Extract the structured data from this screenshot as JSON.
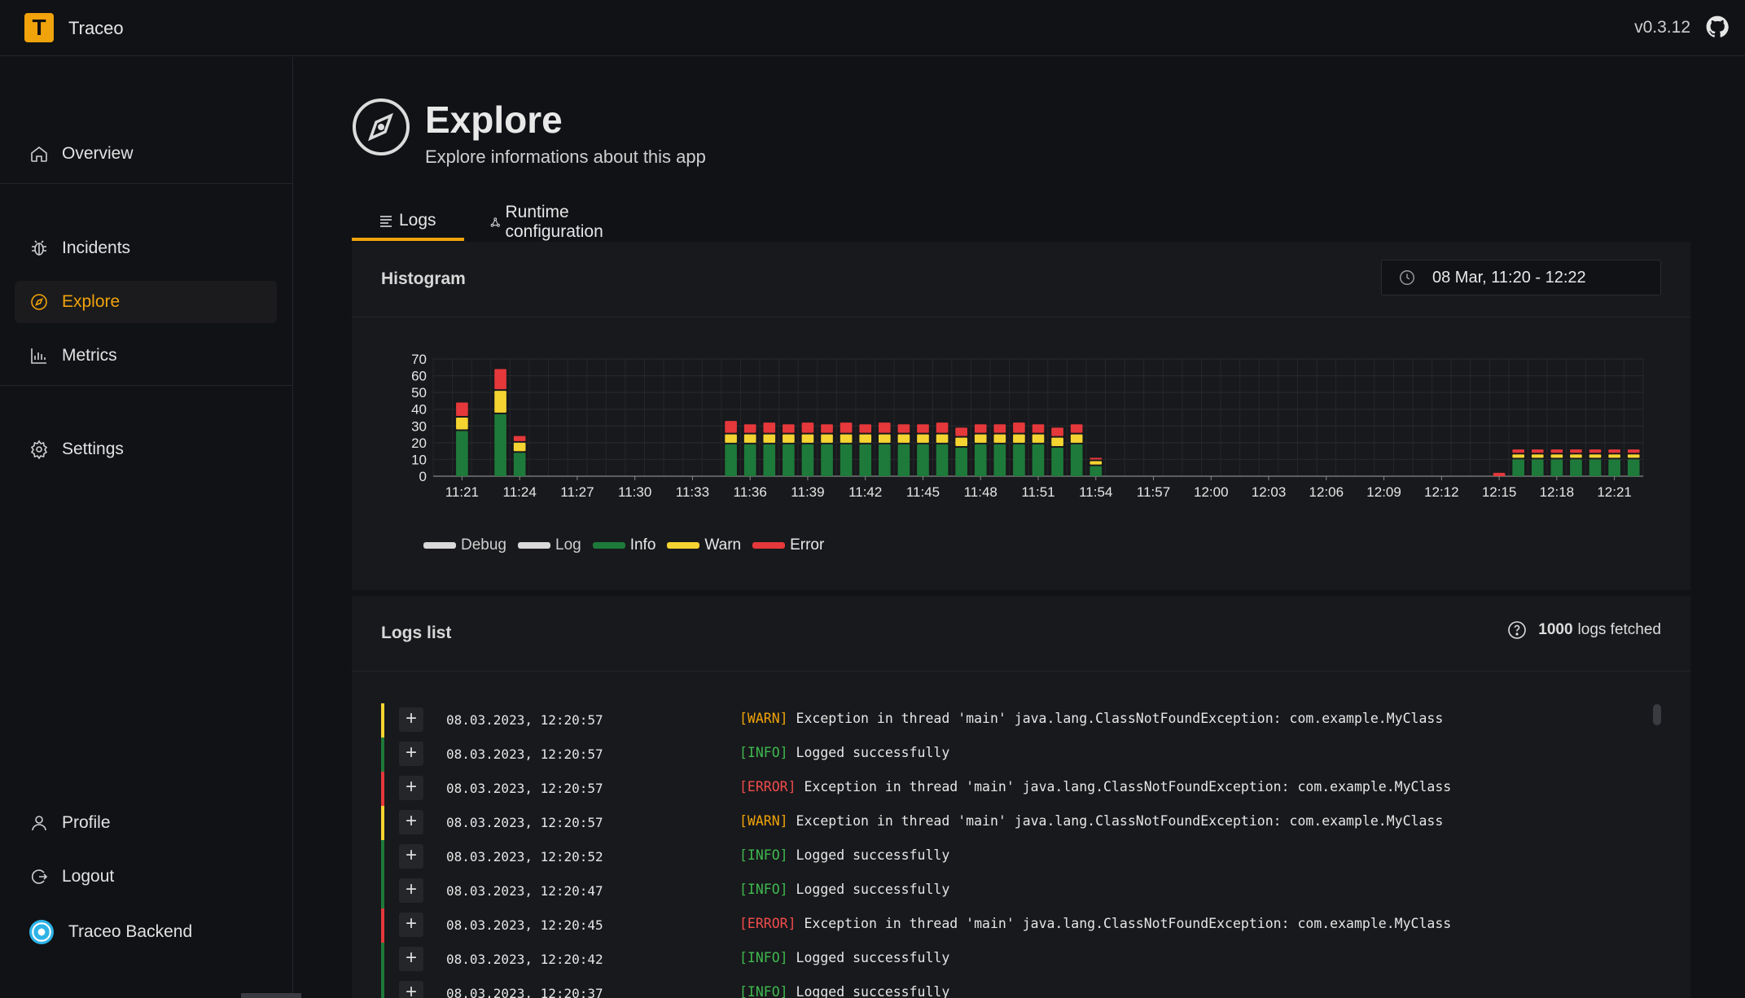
{
  "app": {
    "logo_letter": "T",
    "name": "Traceo",
    "version": "v0.3.12"
  },
  "sidebar": {
    "items": [
      {
        "label": "Overview",
        "icon": "home-icon"
      },
      {
        "label": "Incidents",
        "icon": "bug-icon"
      },
      {
        "label": "Explore",
        "icon": "compass-icon",
        "active": true
      },
      {
        "label": "Metrics",
        "icon": "bar-chart-icon"
      },
      {
        "label": "Settings",
        "icon": "gear-icon"
      }
    ],
    "bottom": [
      {
        "label": "Profile",
        "icon": "user-icon"
      },
      {
        "label": "Logout",
        "icon": "logout-icon"
      },
      {
        "label": "Traceo Backend",
        "icon": "project-avatar"
      }
    ]
  },
  "page": {
    "title": "Explore",
    "subtitle": "Explore informations about this app"
  },
  "tabs": [
    {
      "label": "Logs",
      "active": true
    },
    {
      "label": "Runtime configuration"
    }
  ],
  "histogram": {
    "title": "Histogram",
    "time_range": "08 Mar, 11:20 - 12:22",
    "legend": [
      {
        "label": "Debug",
        "color": "#d9d9d9"
      },
      {
        "label": "Log",
        "color": "#d9d9d9"
      },
      {
        "label": "Info",
        "color": "#1e7a3a"
      },
      {
        "label": "Warn",
        "color": "#f5d431"
      },
      {
        "label": "Error",
        "color": "#e5383b"
      }
    ]
  },
  "chart_data": {
    "type": "bar",
    "stacked": true,
    "y_ticks": [
      0,
      10,
      20,
      30,
      40,
      50,
      60,
      70
    ],
    "ylim": [
      0,
      70
    ],
    "x_ticks": [
      "11:21",
      "11:24",
      "11:27",
      "11:30",
      "11:33",
      "11:36",
      "11:39",
      "11:42",
      "11:45",
      "11:48",
      "11:51",
      "11:54",
      "11:57",
      "12:00",
      "12:03",
      "12:06",
      "12:09",
      "12:12",
      "12:15",
      "12:18",
      "12:21"
    ],
    "x_range_minutes": [
      0,
      63
    ],
    "grid": true,
    "series": [
      {
        "name": "Info",
        "color": "#1e7a3a",
        "bars": [
          [
            1,
            27
          ],
          [
            3,
            37
          ],
          [
            4,
            14
          ],
          [
            15,
            19
          ],
          [
            16,
            19
          ],
          [
            17,
            19
          ],
          [
            18,
            19
          ],
          [
            19,
            19
          ],
          [
            20,
            19
          ],
          [
            21,
            19
          ],
          [
            22,
            19
          ],
          [
            23,
            19
          ],
          [
            24,
            19
          ],
          [
            25,
            19
          ],
          [
            26,
            19
          ],
          [
            27,
            17
          ],
          [
            28,
            19
          ],
          [
            29,
            19
          ],
          [
            30,
            19
          ],
          [
            31,
            19
          ],
          [
            32,
            17
          ],
          [
            33,
            19
          ],
          [
            34,
            6
          ],
          [
            56,
            10
          ],
          [
            57,
            10
          ],
          [
            58,
            10
          ],
          [
            59,
            10
          ],
          [
            60,
            10
          ],
          [
            61,
            10
          ],
          [
            62,
            10
          ]
        ]
      },
      {
        "name": "Warn",
        "color": "#f5d431",
        "bars": [
          [
            1,
            8
          ],
          [
            3,
            14
          ],
          [
            4,
            6
          ],
          [
            15,
            6
          ],
          [
            16,
            6
          ],
          [
            17,
            6
          ],
          [
            18,
            6
          ],
          [
            19,
            6
          ],
          [
            20,
            6
          ],
          [
            21,
            6
          ],
          [
            22,
            6
          ],
          [
            23,
            6
          ],
          [
            24,
            6
          ],
          [
            25,
            6
          ],
          [
            26,
            6
          ],
          [
            27,
            6
          ],
          [
            28,
            6
          ],
          [
            29,
            6
          ],
          [
            30,
            6
          ],
          [
            31,
            6
          ],
          [
            32,
            6
          ],
          [
            33,
            6
          ],
          [
            34,
            3
          ],
          [
            56,
            3
          ],
          [
            57,
            3
          ],
          [
            58,
            3
          ],
          [
            59,
            3
          ],
          [
            60,
            3
          ],
          [
            61,
            3
          ],
          [
            62,
            3
          ]
        ]
      },
      {
        "name": "Error",
        "color": "#e5383b",
        "bars": [
          [
            1,
            9
          ],
          [
            3,
            13
          ],
          [
            4,
            4
          ],
          [
            15,
            8
          ],
          [
            16,
            6
          ],
          [
            17,
            7
          ],
          [
            18,
            6
          ],
          [
            19,
            7
          ],
          [
            20,
            6
          ],
          [
            21,
            7
          ],
          [
            22,
            6
          ],
          [
            23,
            7
          ],
          [
            24,
            6
          ],
          [
            25,
            6
          ],
          [
            26,
            7
          ],
          [
            27,
            6
          ],
          [
            28,
            6
          ],
          [
            29,
            6
          ],
          [
            30,
            7
          ],
          [
            31,
            6
          ],
          [
            32,
            6
          ],
          [
            33,
            6
          ],
          [
            34,
            2
          ],
          [
            55,
            2
          ],
          [
            56,
            3
          ],
          [
            57,
            3
          ],
          [
            58,
            3
          ],
          [
            59,
            3
          ],
          [
            60,
            3
          ],
          [
            61,
            3
          ],
          [
            62,
            3
          ]
        ]
      }
    ]
  },
  "logs": {
    "title": "Logs list",
    "fetched_count": "1000",
    "fetched_suffix": "logs fetched",
    "rows": [
      {
        "time": "08.03.2023, 12:20:57",
        "level": "WARN",
        "tag": "[WARN]",
        "message": "Exception in thread 'main' java.lang.ClassNotFoundException: com.example.MyClass"
      },
      {
        "time": "08.03.2023, 12:20:57",
        "level": "INFO",
        "tag": "[INFO]",
        "message": "Logged successfully"
      },
      {
        "time": "08.03.2023, 12:20:57",
        "level": "ERROR",
        "tag": "[ERROR]",
        "message": "Exception in thread 'main' java.lang.ClassNotFoundException: com.example.MyClass"
      },
      {
        "time": "08.03.2023, 12:20:57",
        "level": "WARN",
        "tag": "[WARN]",
        "message": "Exception in thread 'main' java.lang.ClassNotFoundException: com.example.MyClass"
      },
      {
        "time": "08.03.2023, 12:20:52",
        "level": "INFO",
        "tag": "[INFO]",
        "message": "Logged successfully"
      },
      {
        "time": "08.03.2023, 12:20:47",
        "level": "INFO",
        "tag": "[INFO]",
        "message": "Logged successfully"
      },
      {
        "time": "08.03.2023, 12:20:45",
        "level": "ERROR",
        "tag": "[ERROR]",
        "message": "Exception in thread 'main' java.lang.ClassNotFoundException: com.example.MyClass"
      },
      {
        "time": "08.03.2023, 12:20:42",
        "level": "INFO",
        "tag": "[INFO]",
        "message": "Logged successfully"
      },
      {
        "time": "08.03.2023, 12:20:37",
        "level": "INFO",
        "tag": "[INFO]",
        "message": "Logged successfully"
      }
    ]
  },
  "colors": {
    "accent": "#f0a30a",
    "warn": "#f5d431",
    "info": "#1e7a3a",
    "error": "#e5383b"
  }
}
